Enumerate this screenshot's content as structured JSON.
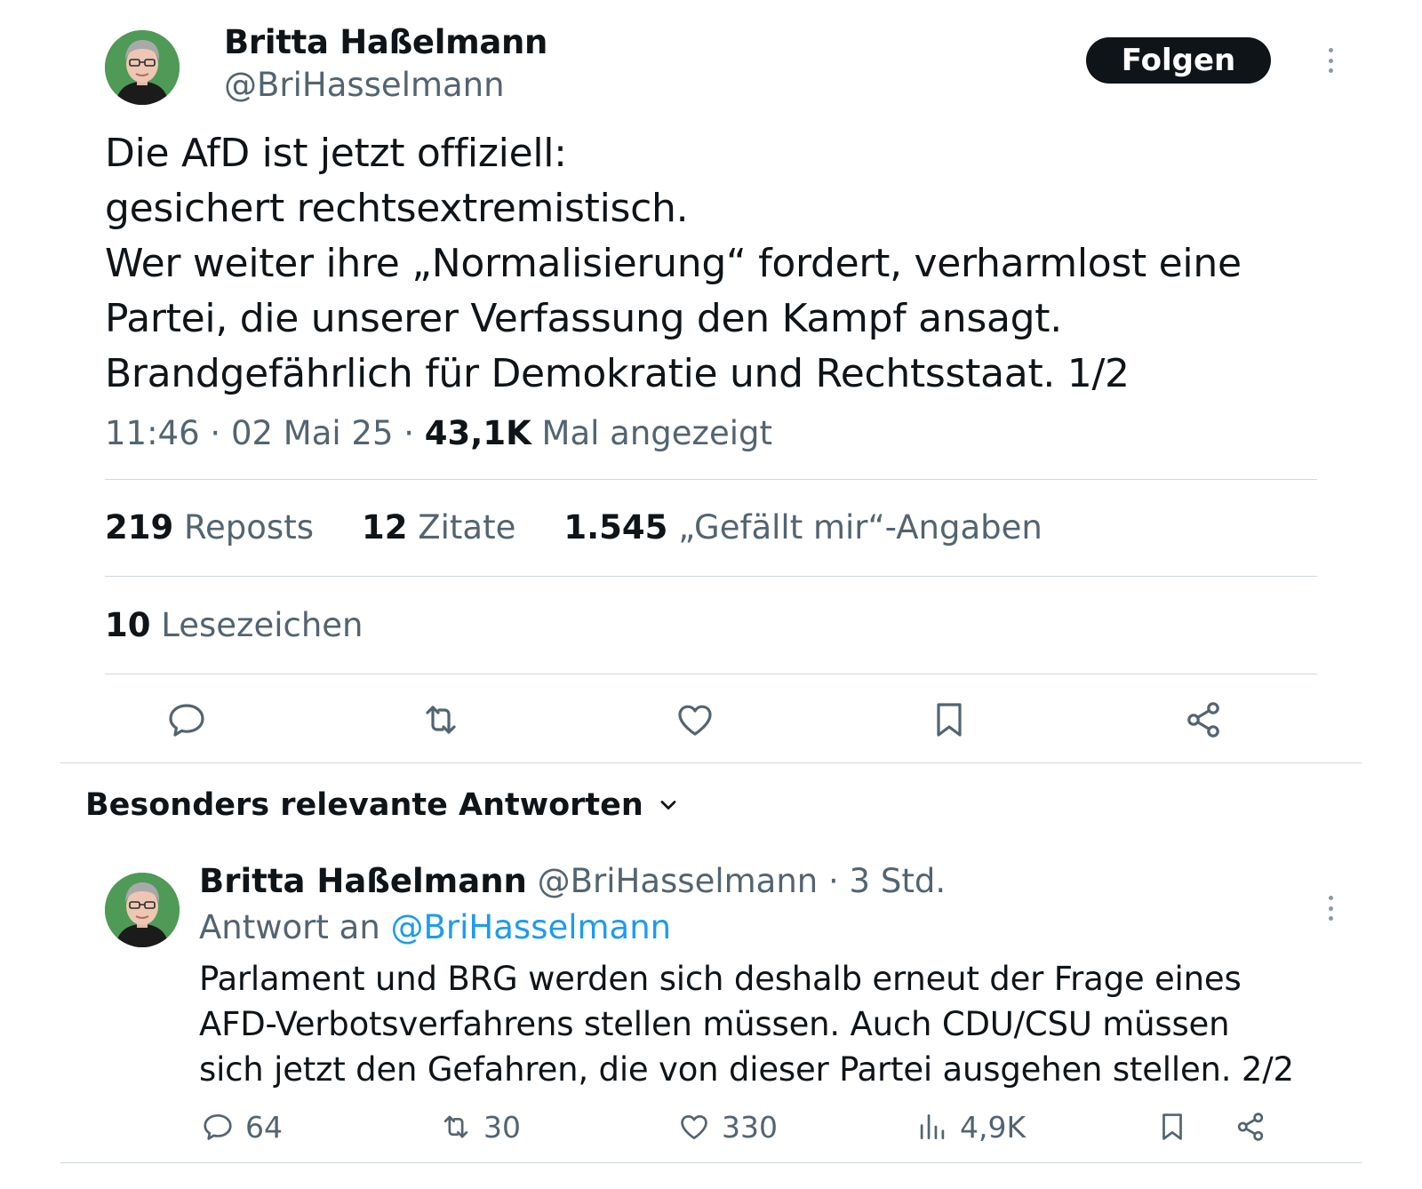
{
  "tweet": {
    "author_name": "Britta Haßelmann",
    "author_handle": "@BriHasselmann",
    "follow_label": "Folgen",
    "text_lines": [
      "Die AfD ist jetzt offiziell:",
      "gesichert rechtsextremistisch.",
      "Wer weiter ihre „Normalisierung“ fordert, verharmlost eine",
      "Partei, die unserer Verfassung den Kampf ansagt.",
      "Brandgefährlich für Demokratie und Rechtsstaat. 1/2"
    ],
    "time": "11:46",
    "date": "02 Mai 25",
    "views_count": "43,1K",
    "views_label": "Mal angezeigt",
    "stats": {
      "reposts_count": "219",
      "reposts_label": "Reposts",
      "quotes_count": "12",
      "quotes_label": "Zitate",
      "likes_count": "1.545",
      "likes_label": "„Gefällt mir“-Angaben",
      "bookmarks_count": "10",
      "bookmarks_label": "Lesezeichen"
    },
    "actions": [
      "reply-icon",
      "repost-icon",
      "like-icon",
      "bookmark-icon",
      "share-icon"
    ]
  },
  "replies_section": {
    "title": "Besonders relevante Antworten"
  },
  "reply": {
    "author_name": "Britta Haßelmann",
    "author_handle": "@BriHasselmann",
    "time_ago": "3 Std.",
    "reply_to_label": "Antwort an",
    "reply_to_handle": "@BriHasselmann",
    "text_lines": [
      "Parlament und BRG werden sich deshalb erneut der Frage eines",
      "AFD-Verbotsverfahrens stellen müssen. Auch CDU/CSU müssen",
      "sich jetzt den Gefahren, die von dieser Partei ausgehen stellen. 2/2"
    ],
    "replies": "64",
    "reposts": "30",
    "likes": "330",
    "views": "4,9K"
  },
  "colors": {
    "text": "#0f1419",
    "secondary": "#536471",
    "link": "#1d9bf0",
    "divider": "#cfd9de",
    "button": "#0f1419"
  }
}
